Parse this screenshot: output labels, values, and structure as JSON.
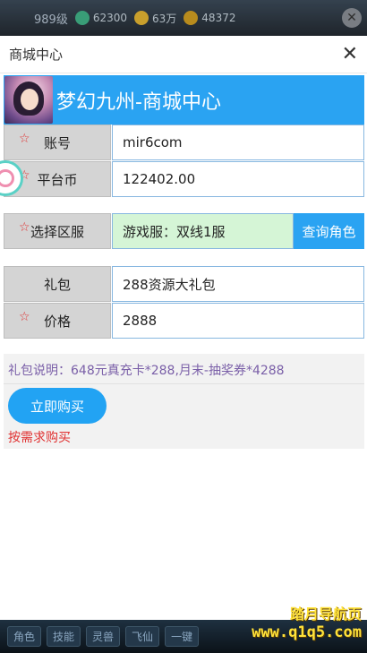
{
  "hud": {
    "level": "989级",
    "stats": [
      {
        "icon": "jade-icon",
        "value": "62300",
        "color": "#3fb58a"
      },
      {
        "icon": "gold-ingot-icon",
        "value": "63万",
        "color": "#e8b832"
      },
      {
        "icon": "coin-icon",
        "value": "48372",
        "color": "#d4a020"
      }
    ],
    "bottom_buttons": [
      "角色",
      "技能",
      "灵兽",
      "飞仙",
      "一键"
    ]
  },
  "dialog": {
    "title": "商城中心"
  },
  "banner": {
    "title": "梦幻九州-商城中心"
  },
  "form": {
    "account": {
      "label": "账号",
      "value": "mir6com",
      "required": true
    },
    "platform_coin": {
      "label": "平台币",
      "value": "122402.00",
      "required": true
    },
    "server": {
      "label": "选择区服",
      "value": "游戏服：双线1服",
      "required": true
    },
    "query_button": "查询角色",
    "gift": {
      "label": "礼包",
      "value": "288资源大礼包",
      "required": false
    },
    "price": {
      "label": "价格",
      "value": "2888",
      "required": true
    }
  },
  "gift_info": {
    "description": "礼包说明：648元真充卡*288,月末-抽奖券*4288",
    "buy_button": "立即购买",
    "note": "按需求购买"
  },
  "watermark": {
    "line1": "踏月导航页",
    "line2": "www.q1q5.com"
  },
  "colors": {
    "accent": "#2aa3f2",
    "required_star": "#e03030",
    "description_text": "#7a5fa8"
  }
}
